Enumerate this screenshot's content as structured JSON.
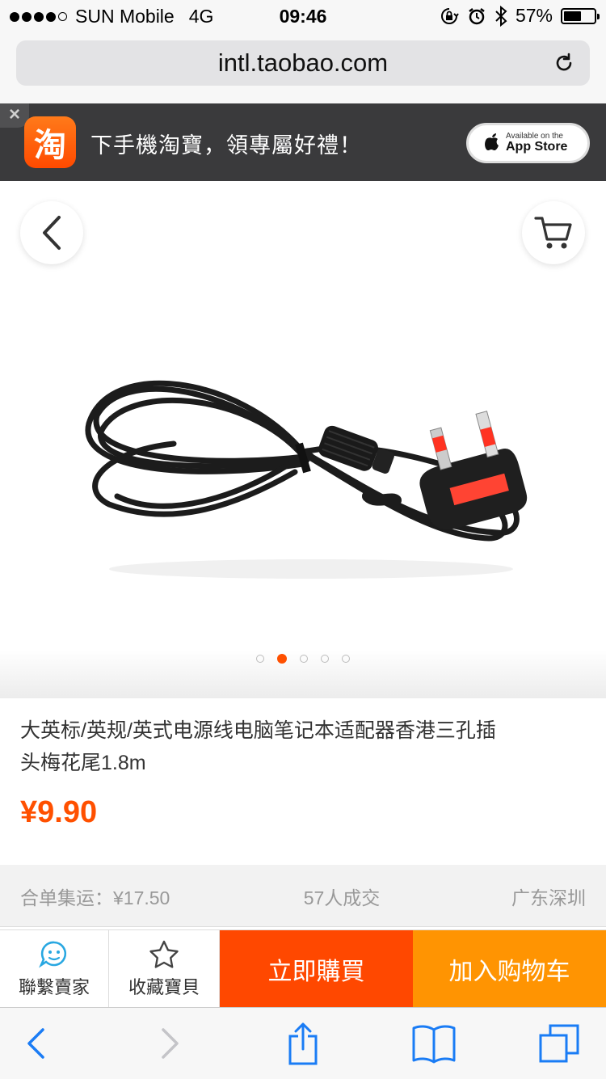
{
  "status_bar": {
    "carrier": "SUN Mobile",
    "network": "4G",
    "time": "09:46",
    "battery": "57%",
    "battery_level": 0.57
  },
  "browser": {
    "url": "intl.taobao.com"
  },
  "banner": {
    "logo_text": "淘",
    "message": "下手機淘寶，領專屬好禮！",
    "appstore_small": "Available on the",
    "appstore_big": "App Store"
  },
  "gallery": {
    "image_count": 5,
    "active_index": 1
  },
  "product": {
    "title": "大英标/英规/英式电源线电脑笔记本适配器香港三孔插头梅花尾1.8m",
    "price": "¥9.90",
    "shipping": "合单集运：¥17.50",
    "sold": "57人成交",
    "location": "广东深圳"
  },
  "actions": {
    "contact_label": "聯繫賣家",
    "favorite_label": "收藏寶貝",
    "buy_label": "立即購買",
    "cart_label": "加入购物车"
  },
  "colors": {
    "price": "#ff5000",
    "buy": "#ff4800",
    "cart": "#ff9402",
    "safari_blue": "#1a7cf5"
  }
}
